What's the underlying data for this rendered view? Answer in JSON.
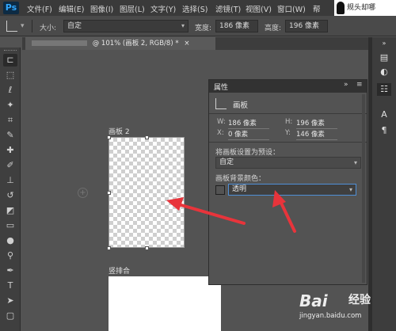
{
  "app": {
    "logo": "Ps"
  },
  "menu": [
    "文件(F)",
    "编辑(E)",
    "图像(I)",
    "图层(L)",
    "文字(Y)",
    "选择(S)",
    "滤镜(T)",
    "视图(V)",
    "窗口(W)",
    "帮"
  ],
  "corner_text": "规头却哪",
  "options": {
    "size_label": "大小:",
    "size_value": "自定",
    "width_label": "宽度:",
    "width_value": "186 像素",
    "height_label": "高度:",
    "height_value": "196 像素"
  },
  "document_tab": {
    "title": "@ 101% (画板 2, RGB/8) *",
    "close": "×"
  },
  "canvas": {
    "artboard_label": "画板 2",
    "artboard2_label": "竖排合",
    "add_symbol": "+"
  },
  "properties": {
    "tab": "属性",
    "collapse": "»",
    "menu": "≡",
    "title": "画板",
    "w_label": "W:",
    "w_value": "186 像素",
    "h_label": "H:",
    "h_value": "196 像素",
    "x_label": "X:",
    "x_value": "0 像素",
    "y_label": "Y:",
    "y_value": "146 像素",
    "preset_label": "将画板设置为预设：",
    "preset_value": "自定",
    "bg_label": "画板背景颜色：",
    "bg_value": "透明"
  },
  "watermark": {
    "brand": "Bai",
    "sub": "经验",
    "url": "jingyan.baidu.com"
  },
  "colors": {
    "arrow": "#e8343b",
    "accent": "#31a8ff"
  }
}
